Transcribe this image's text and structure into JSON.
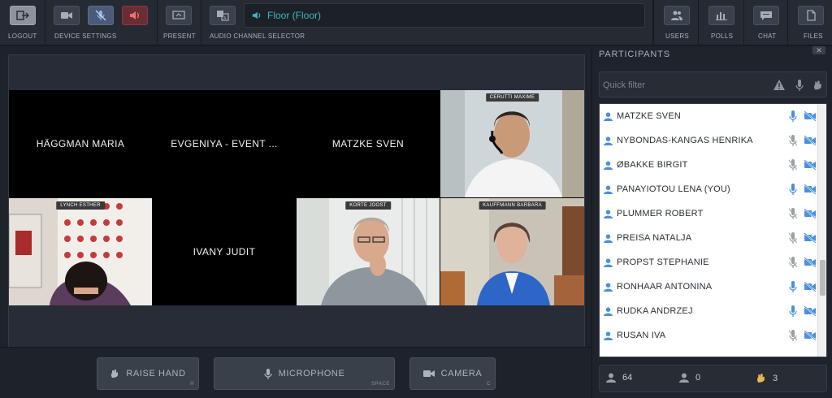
{
  "toolbar": {
    "logout": "LOGOUT",
    "device_settings": "DEVICE SETTINGS",
    "present": "PRESENT",
    "audio_channel_selector": "AUDIO CHANNEL SELECTOR",
    "audio_channel_value": "Floor (Floor)",
    "users": "USERS",
    "polls": "POLLS",
    "chat": "CHAT",
    "files": "FILES"
  },
  "tiles": [
    {
      "name": "HÄGGMAN MARIA",
      "type": "name"
    },
    {
      "name": "EVGENIYA - EVENT ...",
      "type": "name"
    },
    {
      "name": "MATZKE SVEN",
      "type": "name"
    },
    {
      "tag": "CERUTTI MAXIME",
      "type": "video"
    },
    {
      "tag": "LYNCH ESTHER",
      "type": "video"
    },
    {
      "name": "IVANY JUDIT",
      "type": "name"
    },
    {
      "tag": "KORTE JOOST",
      "type": "video"
    },
    {
      "tag": "KAUFFMANN BARBARA",
      "type": "video"
    }
  ],
  "bottom": {
    "raise_hand": "RAISE HAND",
    "raise_hand_key": "H",
    "microphone": "MICROPHONE",
    "microphone_key": "SPACE",
    "camera": "CAMERA",
    "camera_key": "C"
  },
  "participants": {
    "title": "PARTICIPANTS",
    "filter_placeholder": "Quick filter",
    "list": [
      {
        "name": "MATZKE SVEN",
        "mic": "on"
      },
      {
        "name": "NYBONDAS-KANGAS HENRIKA",
        "mic": "off"
      },
      {
        "name": "ØBAKKE BIRGIT",
        "mic": "off"
      },
      {
        "name": "PANAYIOTOU LENA (YOU)",
        "mic": "on"
      },
      {
        "name": "PLUMMER ROBERT",
        "mic": "off"
      },
      {
        "name": "PREISA NATALJA",
        "mic": "off"
      },
      {
        "name": "PROPST STEPHANIE",
        "mic": "off"
      },
      {
        "name": "RONHAAR ANTONINA",
        "mic": "on"
      },
      {
        "name": "RUDKA ANDRZEJ",
        "mic": "on"
      },
      {
        "name": "RUSAN IVA",
        "mic": "off"
      }
    ],
    "count_total": "64",
    "count_other": "0",
    "count_hands": "3"
  },
  "colors": {
    "accent_teal": "#3fb7c4",
    "mic_on": "#4a90d9",
    "mic_off": "#9aa0a8",
    "hand": "#e8b94a",
    "red": "#e05050"
  }
}
